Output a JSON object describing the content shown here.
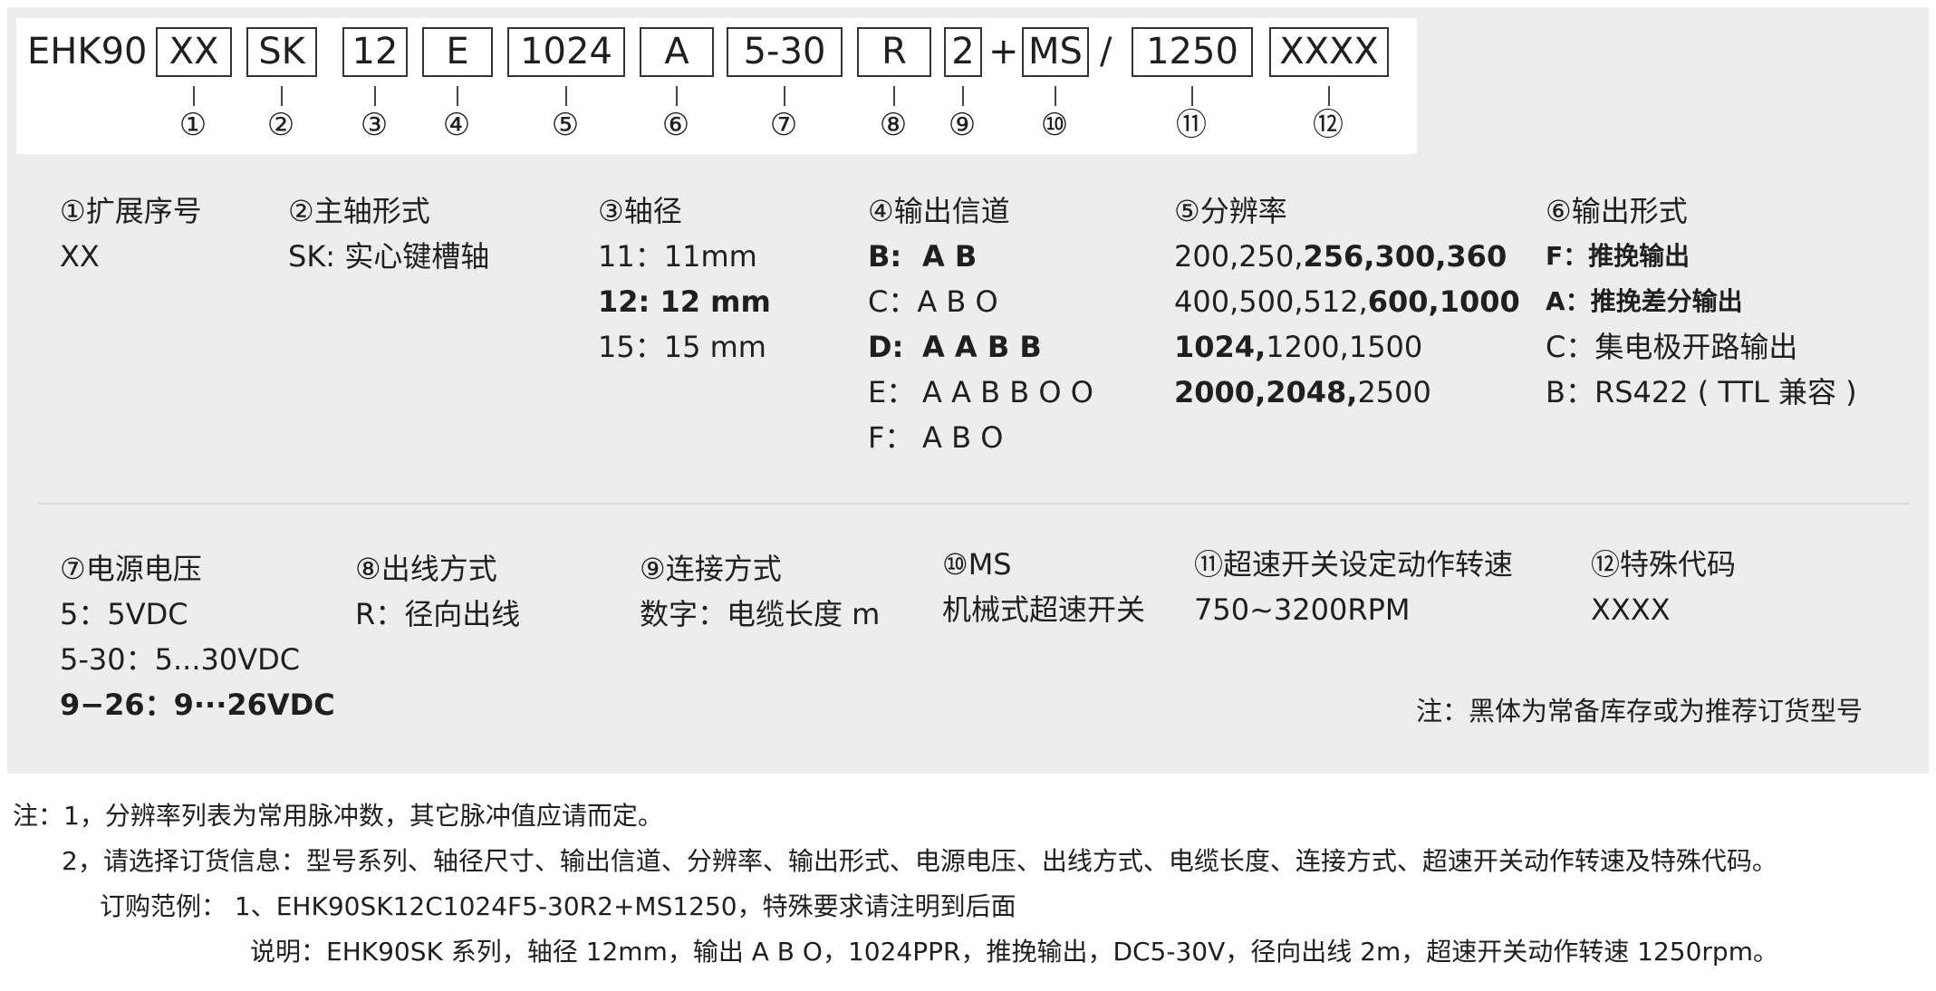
{
  "code": {
    "prefix": "EHK90",
    "segments": [
      "XX",
      "SK",
      "12",
      "E",
      "1024",
      "A",
      "5-30",
      "R",
      "2",
      "MS",
      "1250",
      "XXXX"
    ],
    "plus": "+",
    "slash": "/",
    "numbers": [
      "①",
      "②",
      "③",
      "④",
      "⑤",
      "⑥",
      "⑦",
      "⑧",
      "⑨",
      "⑩",
      "⑪",
      "⑫"
    ]
  },
  "sections": {
    "s1": {
      "title": "①扩展序号",
      "lines": [
        "XX"
      ]
    },
    "s2": {
      "title": "②主轴形式",
      "lines": [
        "SK: 实心键槽轴"
      ]
    },
    "s3": {
      "title": "③轴径",
      "lines": [
        "11：11mm",
        "12: 12 mm",
        "15：15 mm"
      ]
    },
    "s4": {
      "title": "④输出信道",
      "lines": [
        "B:",
        "A B",
        "C：A B O",
        "D:",
        "A A B B",
        "E：",
        "A A B B O O",
        "F：",
        "A B O"
      ]
    },
    "s5": {
      "title": "⑤分辨率",
      "lines": [
        "200,250,",
        "256,300,360",
        "400,500,512,",
        "600,1000",
        "1024,",
        "1200,1500",
        "2000,2048,",
        "2500"
      ]
    },
    "s6": {
      "title": "⑥输出形式",
      "lines": [
        "F：推挽输出",
        "A：推挽差分输出",
        "C：集电极开路输出",
        "B：RS422 ( TTL 兼容 )"
      ]
    },
    "s7": {
      "title": "⑦电源电压",
      "lines": [
        "5：5VDC",
        "5-30：5...30VDC",
        "9−26：9···26VDC"
      ]
    },
    "s8": {
      "title": "⑧出线方式",
      "lines": [
        "R：径向出线"
      ]
    },
    "s9": {
      "title": "⑨连接方式",
      "lines": [
        "数字：电缆长度 m"
      ]
    },
    "s10": {
      "title": "⑩MS",
      "lines": [
        "机械式超速开关"
      ]
    },
    "s11": {
      "title": "⑪超速开关设定动作转速",
      "lines": [
        "750~3200RPM"
      ]
    },
    "s12": {
      "title": "⑫特殊代码",
      "lines": [
        "XXXX"
      ]
    }
  },
  "stock_note": "注：黑体为常备库存或为推荐订货型号",
  "notes": {
    "n1": "注：1，分辨率列表为常用脉冲数，其它脉冲值应请而定。",
    "n2": "2，请选择订货信息：型号系列、轴径尺寸、输出信道、分辨率、输出形式、电源电压、出线方式、电缆长度、连接方式、超速开关动作转速及特殊代码。",
    "n3": "订购范例： 1、EHK90SK12C1024F5-30R2+MS1250，特殊要求请注明到后面",
    "n4": "说明：EHK90SK 系列，轴径 12mm，输出 A B O，1024PPR，推挽输出，DC5-30V，径向出线 2m，超速开关动作转速 1250rpm。"
  }
}
